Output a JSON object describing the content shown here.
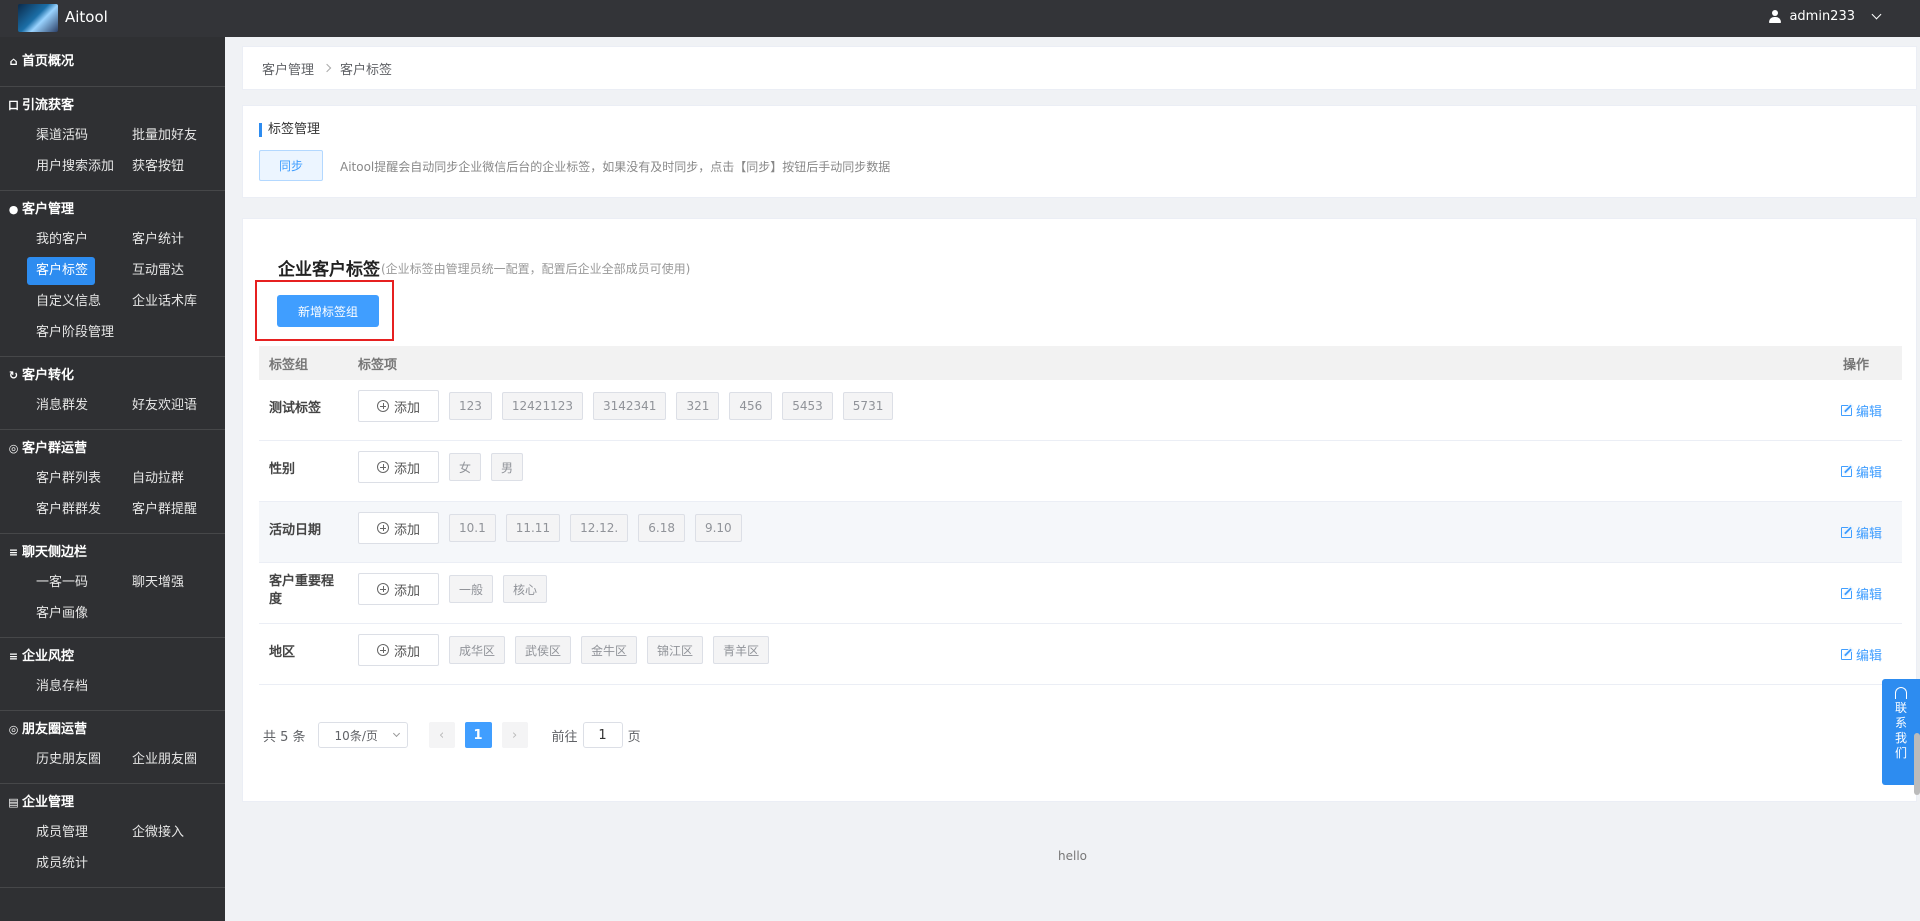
{
  "app": {
    "title": "Aitool",
    "user": "admin233"
  },
  "sidebar": {
    "home": "首页概况",
    "sections": [
      {
        "icon": "attract-icon",
        "glyph": "口",
        "title": "引流获客",
        "items": [
          "渠道活码",
          "批量加好友",
          "用户搜索添加",
          "获客按钮"
        ]
      },
      {
        "icon": "customer-icon",
        "glyph": "●",
        "title": "客户管理",
        "items": [
          "我的客户",
          "客户统计",
          "客户标签",
          "互动雷达",
          "自定义信息",
          "企业话术库",
          "客户阶段管理"
        ]
      },
      {
        "icon": "convert-icon",
        "glyph": "↻",
        "title": "客户转化",
        "items": [
          "消息群发",
          "好友欢迎语"
        ]
      },
      {
        "icon": "group-icon",
        "glyph": "◎",
        "title": "客户群运营",
        "items": [
          "客户群列表",
          "自动拉群",
          "客户群群发",
          "客户群提醒"
        ]
      },
      {
        "icon": "chat-icon",
        "glyph": "≡",
        "title": "聊天侧边栏",
        "items": [
          "一客一码",
          "聊天增强",
          "客户画像"
        ]
      },
      {
        "icon": "risk-icon",
        "glyph": "≡",
        "title": "企业风控",
        "items": [
          "消息存档"
        ]
      },
      {
        "icon": "moments-icon",
        "glyph": "◎",
        "title": "朋友圈运营",
        "items": [
          "历史朋友圈",
          "企业朋友圈"
        ]
      },
      {
        "icon": "enterprise-icon",
        "glyph": "▤",
        "title": "企业管理",
        "items": [
          "成员管理",
          "企微接入",
          "成员统计"
        ]
      }
    ],
    "active": "客户标签"
  },
  "breadcrumb": {
    "parent": "客户管理",
    "current": "客户标签"
  },
  "tag_manage": {
    "title": "标签管理",
    "sync_label": "同步",
    "note": "Aitool提醒会自动同步企业微信后台的企业标签，如果没有及时同步，点击【同步】按钮后手动同步数据"
  },
  "tag_card": {
    "title": "企业客户标签",
    "subtitle": "(企业标签由管理员统一配置，配置后企业全部成员可使用)",
    "add_group_label": "新增标签组",
    "columns": {
      "group": "标签组",
      "items": "标签项",
      "op": "操作"
    },
    "add_label": "添加",
    "edit_label": "编辑",
    "rows": [
      {
        "name": "测试标签",
        "tags": [
          "123",
          "12421123",
          "3142341",
          "321",
          "456",
          "5453",
          "5731"
        ]
      },
      {
        "name": "性别",
        "tags": [
          "女",
          "男"
        ]
      },
      {
        "name": "活动日期",
        "tags": [
          "10.1",
          "11.11",
          "12.12.",
          "6.18",
          "9.10"
        ]
      },
      {
        "name": "客户重要程度",
        "tags": [
          "一般",
          "核心"
        ]
      },
      {
        "name": "地区",
        "tags": [
          "成华区",
          "武侯区",
          "金牛区",
          "锦江区",
          "青羊区"
        ]
      }
    ],
    "pager": {
      "total": "共 5 条",
      "size": "10条/页",
      "current": "1",
      "goto_prefix": "前往",
      "goto_value": "1",
      "goto_suffix": "页"
    }
  },
  "footer": "hello",
  "contact": "联系我们"
}
